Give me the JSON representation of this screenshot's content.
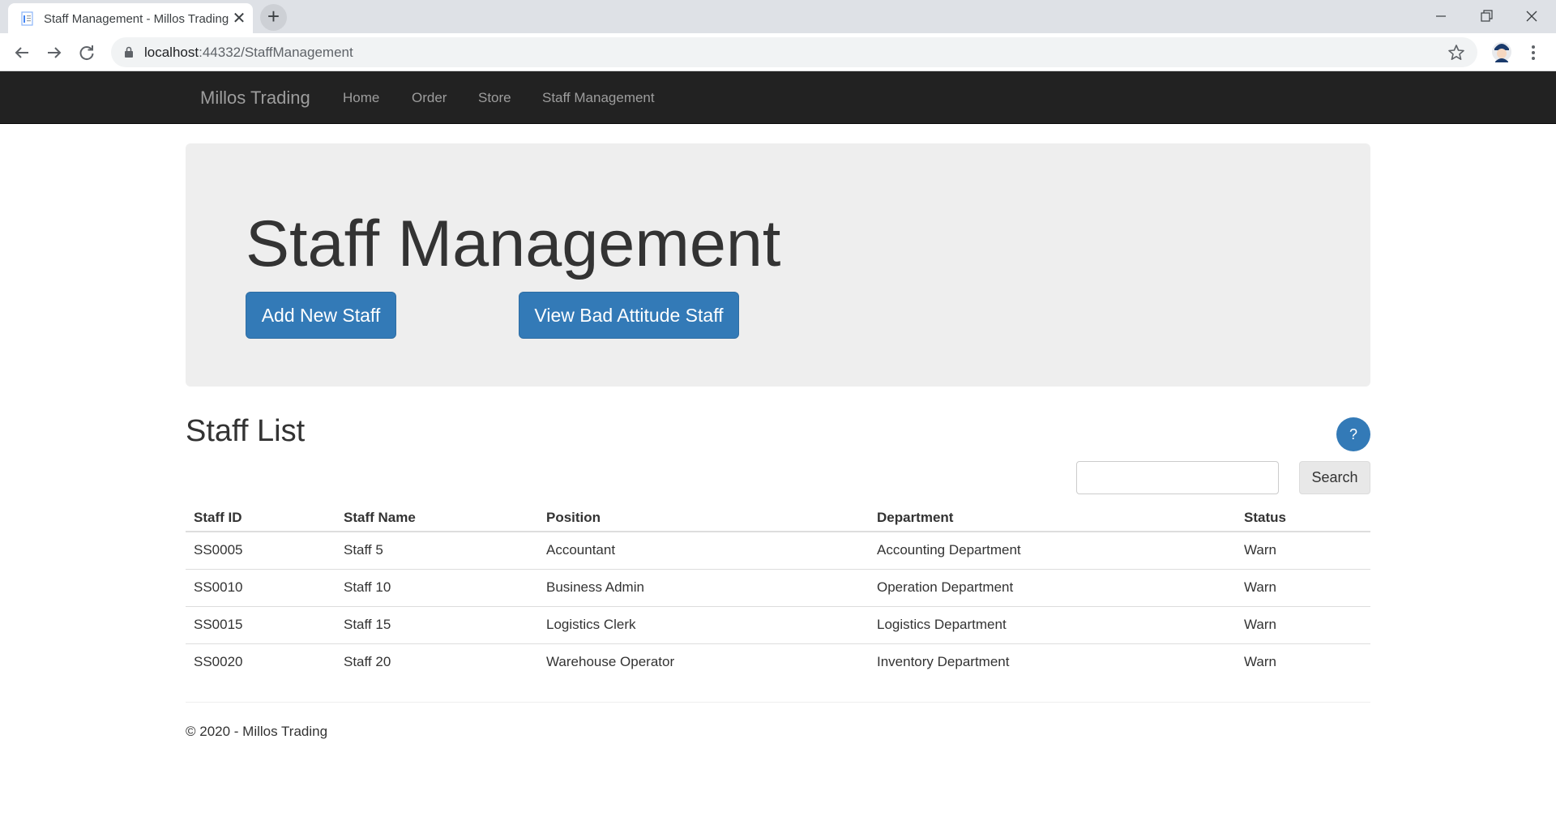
{
  "browser": {
    "tab_title": "Staff Management - Millos Trading",
    "new_tab_symbol": "+",
    "close_symbol": "✕",
    "url_host": "localhost",
    "url_path": ":44332/StaffManagement"
  },
  "navbar": {
    "brand": "Millos Trading",
    "links": [
      "Home",
      "Order",
      "Store",
      "Staff Management"
    ]
  },
  "jumbotron": {
    "title": "Staff Management",
    "add_button": "Add New Staff",
    "bad_attitude_button": "View Bad Attitude Staff"
  },
  "staff_list": {
    "title": "Staff List",
    "help_label": "?",
    "search_value": "",
    "search_button": "Search",
    "columns": [
      "Staff ID",
      "Staff Name",
      "Position",
      "Department",
      "Status"
    ],
    "rows": [
      [
        "SS0005",
        "Staff 5",
        "Accountant",
        "Accounting Department",
        "Warn"
      ],
      [
        "SS0010",
        "Staff 10",
        "Business Admin",
        "Operation Department",
        "Warn"
      ],
      [
        "SS0015",
        "Staff 15",
        "Logistics Clerk",
        "Logistics Department",
        "Warn"
      ],
      [
        "SS0020",
        "Staff 20",
        "Warehouse Operator",
        "Inventory Department",
        "Warn"
      ]
    ]
  },
  "footer": {
    "text": "© 2020 - Millos Trading"
  },
  "colors": {
    "navbar_bg": "#222222",
    "jumbotron_bg": "#eeeeee",
    "primary": "#337ab7",
    "text": "#333333"
  },
  "icons": {
    "tab_favicon": "document-icon",
    "back": "arrow-left-icon",
    "forward": "arrow-right-icon",
    "reload": "reload-icon",
    "lock": "lock-icon",
    "bookmark": "star-icon",
    "profile": "avatar-icon",
    "menu": "kebab-menu-icon"
  }
}
